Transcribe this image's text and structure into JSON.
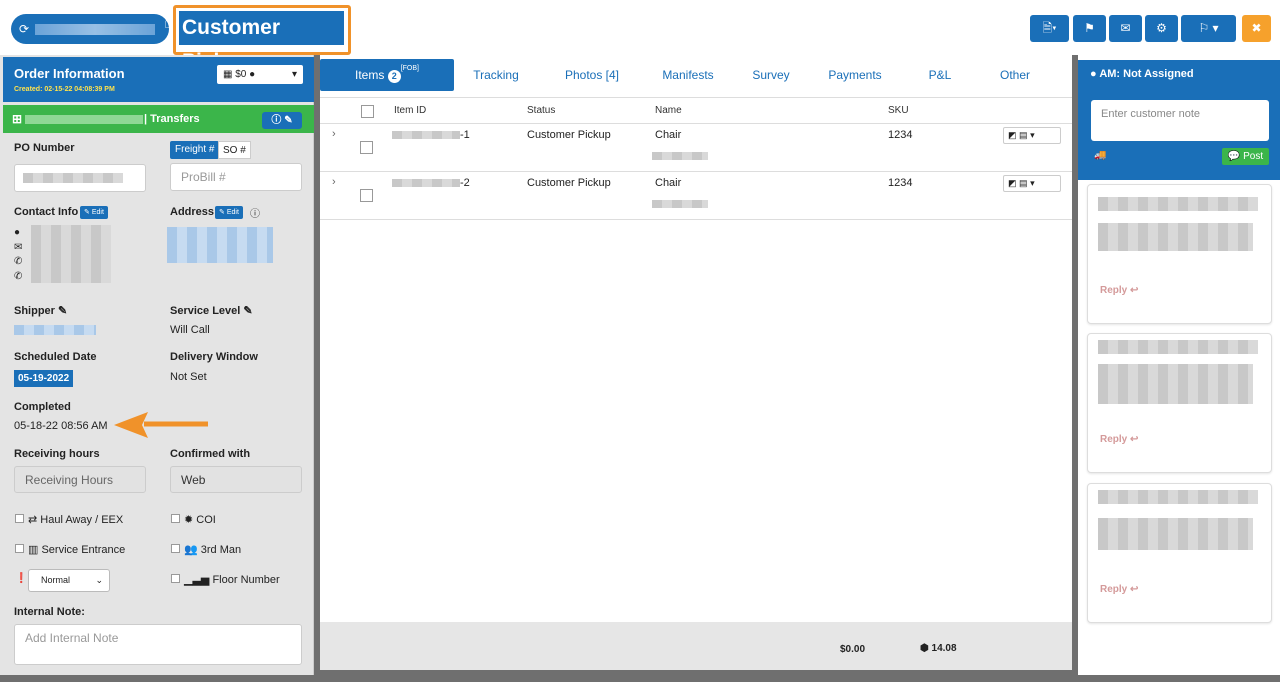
{
  "header": {
    "title": "Customer Pickup",
    "icons": [
      "refresh-icon",
      "copy-icon",
      "document-icon",
      "flag-icon",
      "envelope-icon",
      "gear-icon",
      "signpost-icon",
      "close-icon"
    ]
  },
  "order_info": {
    "title": "Order Information",
    "created": "Created: 02-15-22 04:08:39 PM",
    "price_select": "$0",
    "group_label": "| Transfers",
    "po_label": "PO Number",
    "freight_tab": "Freight #",
    "so_tab": "SO #",
    "probill_placeholder": "ProBill #",
    "contact_label": "Contact Info",
    "edit_label": "Edit",
    "address_label": "Address",
    "shipper_label": "Shipper",
    "service_level_label": "Service Level",
    "service_level_value": "Will Call",
    "scheduled_label": "Scheduled Date",
    "scheduled_value": "05-19-2022",
    "delivery_window_label": "Delivery Window",
    "delivery_window_value": "Not Set",
    "completed_label": "Completed",
    "completed_value": "05-18-22 08:56 AM",
    "receiving_label": "Receiving hours",
    "receiving_placeholder": "Receiving Hours",
    "confirmed_label": "Confirmed with",
    "confirmed_value": "Web",
    "haul_away": "Haul Away / EEX",
    "coi": "COI",
    "service_entrance": "Service Entrance",
    "third_man": "3rd Man",
    "priority_value": "Normal",
    "floor_number": "Floor Number",
    "internal_note_label": "Internal Note:",
    "internal_note_placeholder": "Add Internal Note"
  },
  "tabs": [
    {
      "label": "Items",
      "badge": "2",
      "sup": "[FOB]"
    },
    {
      "label": "Tracking"
    },
    {
      "label": "Photos [4]"
    },
    {
      "label": "Manifests"
    },
    {
      "label": "Survey"
    },
    {
      "label": "Payments"
    },
    {
      "label": "P&L"
    },
    {
      "label": "Other"
    }
  ],
  "grid": {
    "headers": [
      "Item ID",
      "Status",
      "Name",
      "SKU"
    ],
    "rows": [
      {
        "id_suffix": "-1",
        "status": "Customer Pickup",
        "name": "Chair",
        "sku": "1234"
      },
      {
        "id_suffix": "-2",
        "status": "Customer Pickup",
        "name": "Chair",
        "sku": "1234"
      }
    ],
    "footer_total": "$0.00",
    "footer_cube": "14.08"
  },
  "notes": {
    "am_label": "AM: Not Assigned",
    "note_placeholder": "Enter customer note",
    "post_label": "Post",
    "reply_label": "Reply"
  },
  "colors": {
    "primary": "#1a6fb8",
    "green": "#3bb54a",
    "orange": "#f0922a"
  }
}
